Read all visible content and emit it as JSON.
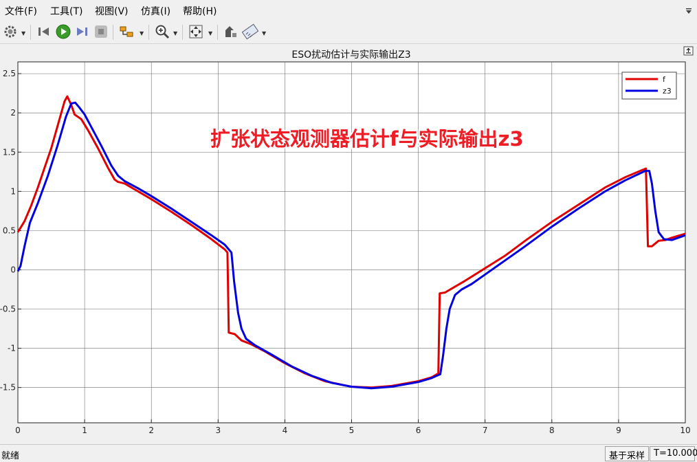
{
  "menu": {
    "items": [
      "文件(F)",
      "工具(T)",
      "视图(V)",
      "仿真(I)",
      "帮助(H)"
    ]
  },
  "toolbar": {
    "icons": [
      "gear-icon",
      "step-back-icon",
      "run-icon",
      "step-forward-icon",
      "stop-icon",
      "signal-highlight-icon",
      "zoom-in-icon",
      "fit-view-icon",
      "cursor-measure-icon",
      "style-icon"
    ]
  },
  "status": {
    "text": "就绪",
    "mode": "基于采样",
    "time": "T=10.000"
  },
  "chart_data": {
    "type": "line",
    "title": "ESO扰动估计与实际输出Z3",
    "annotation": "扩张状态观测器估计f与实际输出z3",
    "xlabel": "",
    "ylabel": "",
    "xlim": [
      0,
      10
    ],
    "ylim": [
      -1.95,
      2.65
    ],
    "xticks": [
      0,
      1,
      2,
      3,
      4,
      5,
      6,
      7,
      8,
      9,
      10
    ],
    "yticks": [
      -1.5,
      -1,
      -0.5,
      0,
      0.5,
      1,
      1.5,
      2,
      2.5
    ],
    "xtick_labels": [
      "0",
      "1",
      "2",
      "3",
      "4",
      "5",
      "6",
      "7",
      "8",
      "9",
      "10"
    ],
    "ytick_labels": [
      "-1.5",
      "-1",
      "-0.5",
      "0",
      "0.5",
      "1",
      "1.5",
      "2",
      "2.5"
    ],
    "grid": true,
    "legend_position": "top-right",
    "series": [
      {
        "name": "f",
        "color": "#e00000",
        "points": [
          [
            0,
            0.48
          ],
          [
            0.1,
            0.62
          ],
          [
            0.2,
            0.82
          ],
          [
            0.3,
            1.05
          ],
          [
            0.4,
            1.3
          ],
          [
            0.5,
            1.55
          ],
          [
            0.6,
            1.85
          ],
          [
            0.7,
            2.15
          ],
          [
            0.74,
            2.21
          ],
          [
            0.8,
            2.1
          ],
          [
            0.85,
            1.98
          ],
          [
            0.95,
            1.92
          ],
          [
            1.05,
            1.78
          ],
          [
            1.2,
            1.55
          ],
          [
            1.35,
            1.3
          ],
          [
            1.45,
            1.15
          ],
          [
            1.5,
            1.12
          ],
          [
            1.6,
            1.1
          ],
          [
            1.8,
            1.0
          ],
          [
            2.0,
            0.9
          ],
          [
            2.3,
            0.74
          ],
          [
            2.6,
            0.57
          ],
          [
            2.9,
            0.39
          ],
          [
            3.1,
            0.26
          ],
          [
            3.14,
            0.22
          ],
          [
            3.16,
            -0.8
          ],
          [
            3.25,
            -0.82
          ],
          [
            3.35,
            -0.9
          ],
          [
            3.5,
            -0.95
          ],
          [
            3.7,
            -1.04
          ],
          [
            4.0,
            -1.19
          ],
          [
            4.3,
            -1.32
          ],
          [
            4.6,
            -1.42
          ],
          [
            5.0,
            -1.49
          ],
          [
            5.3,
            -1.5
          ],
          [
            5.6,
            -1.48
          ],
          [
            6.0,
            -1.42
          ],
          [
            6.2,
            -1.37
          ],
          [
            6.3,
            -1.32
          ],
          [
            6.32,
            -0.3
          ],
          [
            6.4,
            -0.29
          ],
          [
            6.5,
            -0.24
          ],
          [
            6.7,
            -0.14
          ],
          [
            7.0,
            0.02
          ],
          [
            7.3,
            0.18
          ],
          [
            7.6,
            0.37
          ],
          [
            8.0,
            0.61
          ],
          [
            8.4,
            0.83
          ],
          [
            8.8,
            1.05
          ],
          [
            9.1,
            1.18
          ],
          [
            9.35,
            1.27
          ],
          [
            9.41,
            1.29
          ],
          [
            9.44,
            0.3
          ],
          [
            9.5,
            0.3
          ],
          [
            9.6,
            0.37
          ],
          [
            9.7,
            0.38
          ],
          [
            9.8,
            0.41
          ],
          [
            10.0,
            0.46
          ]
        ]
      },
      {
        "name": "z3",
        "color": "#0000e0",
        "points": [
          [
            0,
            -0.02
          ],
          [
            0.04,
            0.05
          ],
          [
            0.1,
            0.3
          ],
          [
            0.18,
            0.6
          ],
          [
            0.3,
            0.85
          ],
          [
            0.45,
            1.2
          ],
          [
            0.6,
            1.6
          ],
          [
            0.72,
            1.95
          ],
          [
            0.8,
            2.12
          ],
          [
            0.86,
            2.13
          ],
          [
            0.92,
            2.07
          ],
          [
            1.0,
            1.98
          ],
          [
            1.1,
            1.82
          ],
          [
            1.25,
            1.58
          ],
          [
            1.4,
            1.33
          ],
          [
            1.5,
            1.2
          ],
          [
            1.6,
            1.13
          ],
          [
            1.8,
            1.04
          ],
          [
            2.0,
            0.94
          ],
          [
            2.3,
            0.78
          ],
          [
            2.6,
            0.61
          ],
          [
            2.9,
            0.44
          ],
          [
            3.1,
            0.32
          ],
          [
            3.2,
            0.22
          ],
          [
            3.24,
            -0.15
          ],
          [
            3.3,
            -0.55
          ],
          [
            3.35,
            -0.75
          ],
          [
            3.42,
            -0.88
          ],
          [
            3.55,
            -0.96
          ],
          [
            3.8,
            -1.08
          ],
          [
            4.1,
            -1.23
          ],
          [
            4.4,
            -1.35
          ],
          [
            4.7,
            -1.44
          ],
          [
            5.0,
            -1.49
          ],
          [
            5.3,
            -1.51
          ],
          [
            5.6,
            -1.49
          ],
          [
            6.0,
            -1.43
          ],
          [
            6.2,
            -1.38
          ],
          [
            6.33,
            -1.33
          ],
          [
            6.37,
            -1.1
          ],
          [
            6.42,
            -0.75
          ],
          [
            6.47,
            -0.5
          ],
          [
            6.55,
            -0.32
          ],
          [
            6.65,
            -0.25
          ],
          [
            6.8,
            -0.18
          ],
          [
            7.0,
            -0.06
          ],
          [
            7.3,
            0.12
          ],
          [
            7.6,
            0.3
          ],
          [
            8.0,
            0.55
          ],
          [
            8.4,
            0.78
          ],
          [
            8.8,
            1.0
          ],
          [
            9.1,
            1.14
          ],
          [
            9.4,
            1.26
          ],
          [
            9.46,
            1.26
          ],
          [
            9.5,
            1.1
          ],
          [
            9.55,
            0.75
          ],
          [
            9.6,
            0.48
          ],
          [
            9.68,
            0.39
          ],
          [
            9.8,
            0.38
          ],
          [
            10.0,
            0.44
          ]
        ]
      }
    ]
  }
}
